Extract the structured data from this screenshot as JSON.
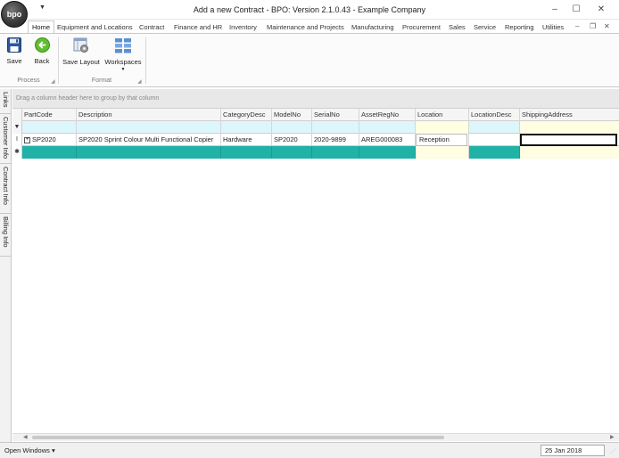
{
  "window": {
    "title": "Add a new Contract - BPO: Version 2.1.0.43 - Example Company",
    "logo_text": "bpo",
    "minimize": "–",
    "maximize": "☐",
    "close": "✕"
  },
  "tabs": [
    "Home",
    "Equipment and Locations",
    "Contract",
    "Finance and HR",
    "Inventory",
    "Maintenance and Projects",
    "Manufacturing",
    "Procurement",
    "Sales",
    "Service",
    "Reporting",
    "Utilities"
  ],
  "tab_controls": {
    "minimize": "–",
    "restore": "❐",
    "close": "✕"
  },
  "ribbon": {
    "save": "Save",
    "back": "Back",
    "save_layout": "Save Layout",
    "workspaces": "Workspaces",
    "group_process": "Process",
    "group_format": "Format"
  },
  "side_tabs": [
    "Links",
    "Customer Info",
    "Contract Info",
    "Billing Info"
  ],
  "grid": {
    "group_hint": "Drag a column header here to group by that column",
    "columns": [
      "PartCode",
      "Description",
      "CategoryDesc",
      "ModelNo",
      "SerialNo",
      "AssetRegNo",
      "Location",
      "LocationDesc",
      "ShippingAddress"
    ],
    "filter_indicator": "▼",
    "row_indicator": "I",
    "new_row_indicator": "✱",
    "expand_symbol": "+",
    "row": {
      "PartCode": "SP2020",
      "Description": "SP2020 Sprint Colour Multi Functional Copier",
      "CategoryDesc": "Hardware",
      "ModelNo": "SP2020",
      "SerialNo": "2020-9899",
      "AssetRegNo": "AREG000083",
      "Location": "Reception",
      "LocationDesc": "",
      "ShippingAddress": ""
    }
  },
  "status": {
    "open_windows": "Open Windows ▾",
    "date": "25 Jan 2018"
  },
  "colors": {
    "new_row": "#20b2a6",
    "filter_row": "#ddf6fb",
    "highlight_cell": "#fffde2"
  }
}
